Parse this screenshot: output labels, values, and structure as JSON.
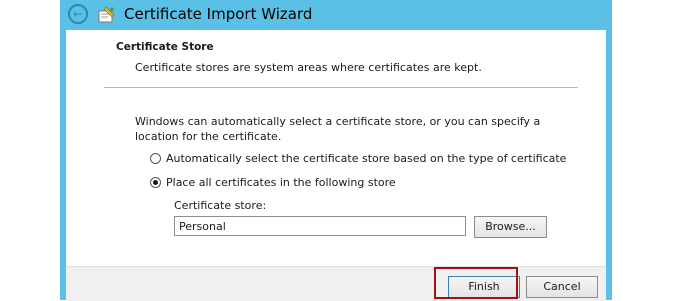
{
  "window": {
    "title": "Certificate Import Wizard",
    "back_icon": "arrow-left-icon",
    "app_icon": "certificate-wizard-icon"
  },
  "header": {
    "title": "Certificate Store",
    "description": "Certificate stores are system areas where certificates are kept."
  },
  "body": {
    "intro": "Windows can automatically select a certificate store, or you can specify a location for the certificate.",
    "options": [
      {
        "label": "Automatically select the certificate store based on the type of certificate",
        "checked": false
      },
      {
        "label": "Place all certificates in the following store",
        "checked": true
      }
    ],
    "store_label": "Certificate store:",
    "store_value": "Personal",
    "browse_label": "Browse..."
  },
  "footer": {
    "finish_label": "Finish",
    "cancel_label": "Cancel"
  },
  "colors": {
    "frame": "#5bc0e6",
    "highlight": "#a40f14",
    "footer": "#f0f0f0"
  }
}
